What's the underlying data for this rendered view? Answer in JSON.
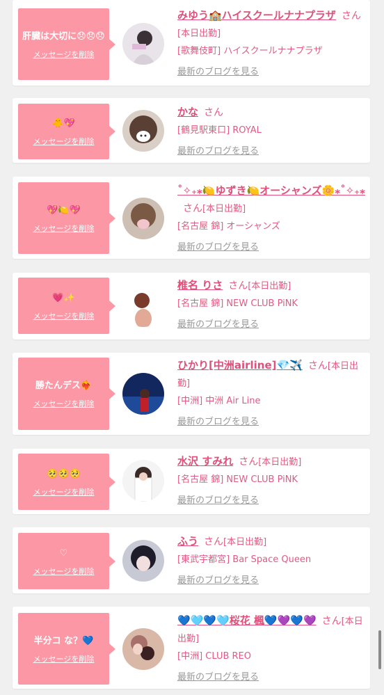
{
  "delete_label": "メッセージを削除",
  "blog_label": "最新のブログを見る",
  "san_label": "さん",
  "colors": {
    "bubble": "#fc98a6",
    "name": "#e0507a",
    "text": "#e25a83",
    "link_gray": "#999999"
  },
  "items": [
    {
      "message": "肝臓は大切に😞😞😞",
      "name": "みゆう🏫ハイスクールナナプラザ",
      "status": "[本日出勤]",
      "shop": "[歌舞伎町] ハイスクールナナプラザ"
    },
    {
      "message": "🐥💖",
      "name": "かな",
      "status": "",
      "shop": "[鶴見駅東口] ROYAL"
    },
    {
      "message": "💖🍋💖",
      "name": "˚✧₊⁎🍋ゆずき🍋オーシャンズ🌼⁎˚✧₊⁎",
      "status": "[本日出勤]",
      "shop": "[名古屋 錦] オーシャンズ"
    },
    {
      "message": "💗✨",
      "name": "椎名 りさ",
      "status": "[本日出勤]",
      "shop": "[名古屋 錦] NEW CLUB PiNK"
    },
    {
      "message": "勝たんデス❤️‍🔥",
      "name": "ひかり[中洲airline]💎✈️",
      "status": "[本日出勤]",
      "shop": "[中洲] 中洲 Air Line"
    },
    {
      "message": "🥺🥺🥺",
      "name": "水沢 すみれ",
      "status": "[本日出勤]",
      "shop": "[名古屋 錦] NEW CLUB PiNK"
    },
    {
      "message": "♡",
      "name": "ふう",
      "status": "[本日出勤]",
      "shop": "[東武宇都宮] Bar Space Queen"
    },
    {
      "message": "半分コ な？💙",
      "name": "💙🩵💙🩵桜花 楓💙💜💙💜",
      "status": "[本日出勤]",
      "shop": "[中洲] CLUB REO"
    }
  ]
}
